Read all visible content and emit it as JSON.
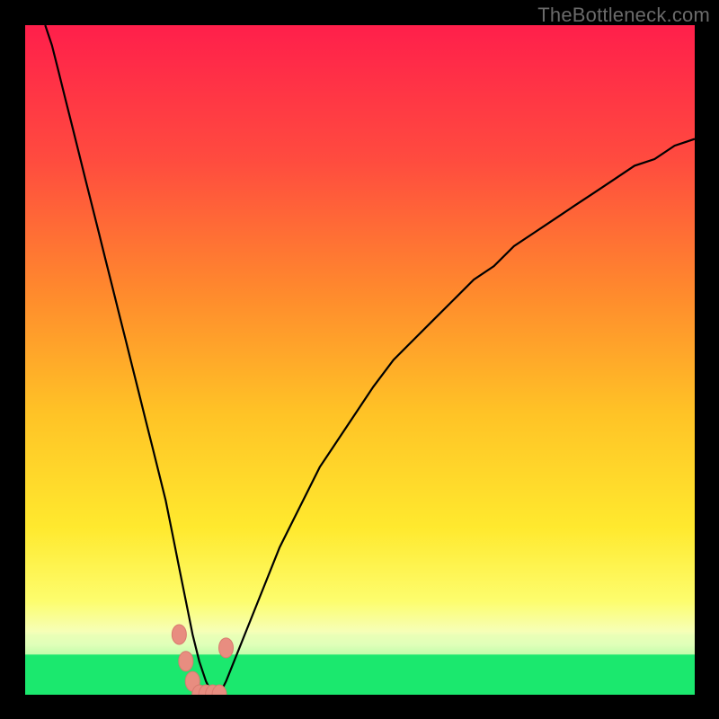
{
  "watermark": "TheBottleneck.com",
  "colors": {
    "black": "#000000",
    "curve": "#000000",
    "marker_fill": "#e88d80",
    "marker_stroke": "#d87a6e",
    "good_band": "#1be86e",
    "good_band_edge": "#e7ffb3",
    "gradient_stops": [
      {
        "offset": 0.0,
        "color": "#ff1f4b"
      },
      {
        "offset": 0.2,
        "color": "#ff4b3f"
      },
      {
        "offset": 0.4,
        "color": "#ff8a2d"
      },
      {
        "offset": 0.58,
        "color": "#ffc326"
      },
      {
        "offset": 0.75,
        "color": "#ffe92e"
      },
      {
        "offset": 0.86,
        "color": "#fdfd6d"
      },
      {
        "offset": 0.905,
        "color": "#f6ffb6"
      },
      {
        "offset": 0.925,
        "color": "#d6ffc1"
      },
      {
        "offset": 0.95,
        "color": "#6cf58f"
      },
      {
        "offset": 1.0,
        "color": "#14e55f"
      }
    ]
  },
  "chart_data": {
    "type": "line",
    "title": "",
    "xlabel": "",
    "ylabel": "",
    "xlim": [
      0,
      100
    ],
    "ylim": [
      0,
      100
    ],
    "x": [
      3,
      4,
      5,
      6,
      7,
      8,
      9,
      10,
      11,
      12,
      13,
      14,
      15,
      16,
      17,
      18,
      19,
      20,
      21,
      22,
      23,
      24,
      25,
      26,
      27,
      28,
      29,
      30,
      32,
      34,
      36,
      38,
      40,
      42,
      44,
      46,
      48,
      50,
      52,
      55,
      58,
      61,
      64,
      67,
      70,
      73,
      76,
      79,
      82,
      85,
      88,
      91,
      94,
      97,
      100
    ],
    "values": [
      100,
      97,
      93,
      89,
      85,
      81,
      77,
      73,
      69,
      65,
      61,
      57,
      53,
      49,
      45,
      41,
      37,
      33,
      29,
      24,
      19,
      14,
      9,
      5,
      2,
      0,
      0,
      2,
      7,
      12,
      17,
      22,
      26,
      30,
      34,
      37,
      40,
      43,
      46,
      50,
      53,
      56,
      59,
      62,
      64,
      67,
      69,
      71,
      73,
      75,
      77,
      79,
      80,
      82,
      83
    ],
    "markers_x": [
      23,
      24,
      25,
      26,
      27,
      28,
      29,
      30
    ],
    "markers_y": [
      9,
      5,
      2,
      0,
      0,
      0,
      0,
      7
    ],
    "optimal_x": 27.5,
    "good_band_y": [
      0,
      6
    ]
  }
}
